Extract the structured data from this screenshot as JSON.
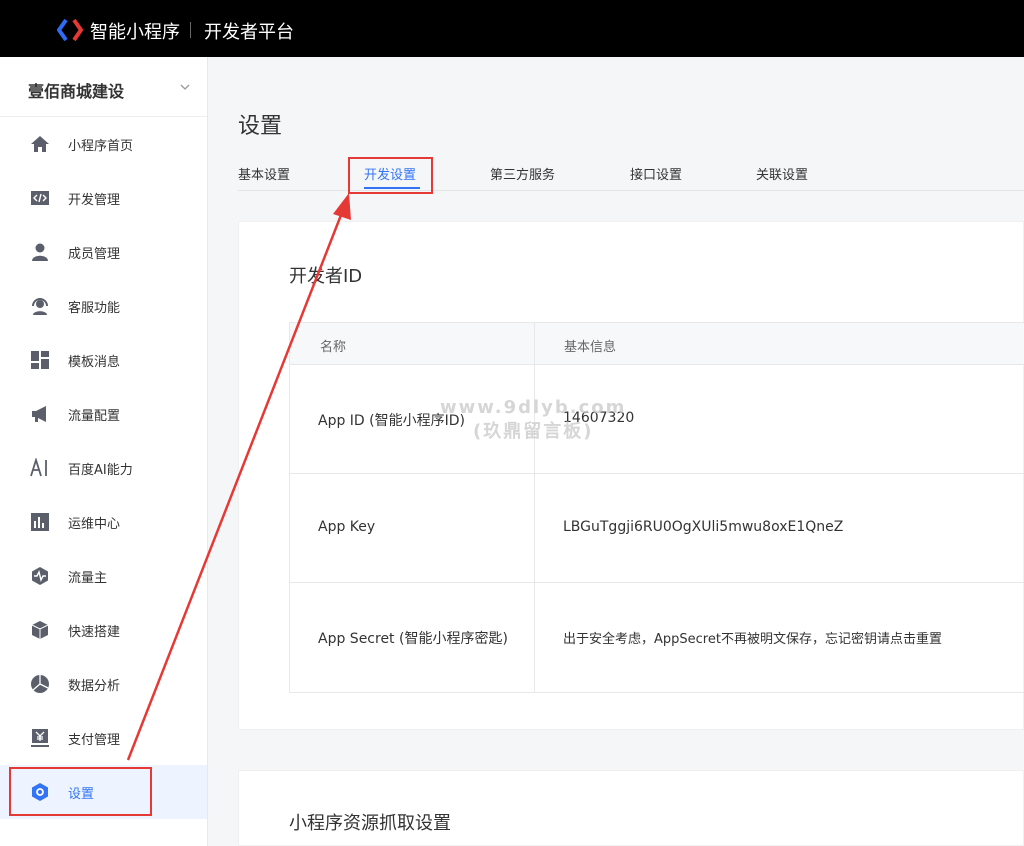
{
  "header": {
    "brand": "智能小程序",
    "subtitle": "开发者平台"
  },
  "sidebar": {
    "account_name": "壹佰商城建设",
    "items": [
      {
        "label": "小程序首页",
        "icon": "home-icon"
      },
      {
        "label": "开发管理",
        "icon": "code-icon"
      },
      {
        "label": "成员管理",
        "icon": "user-icon"
      },
      {
        "label": "客服功能",
        "icon": "headset-icon"
      },
      {
        "label": "模板消息",
        "icon": "template-icon"
      },
      {
        "label": "流量配置",
        "icon": "megaphone-icon"
      },
      {
        "label": "百度AI能力",
        "icon": "ai-icon"
      },
      {
        "label": "运维中心",
        "icon": "bar-chart-icon"
      },
      {
        "label": "流量主",
        "icon": "pulse-icon"
      },
      {
        "label": "快速搭建",
        "icon": "cube-icon"
      },
      {
        "label": "数据分析",
        "icon": "pie-chart-icon"
      },
      {
        "label": "支付管理",
        "icon": "yen-icon"
      },
      {
        "label": "设置",
        "icon": "settings-icon"
      }
    ],
    "active_index": 12
  },
  "main": {
    "title": "设置",
    "tabs": [
      {
        "label": "基本设置"
      },
      {
        "label": "开发设置"
      },
      {
        "label": "第三方服务"
      },
      {
        "label": "接口设置"
      },
      {
        "label": "关联设置"
      }
    ],
    "active_tab": 1,
    "developer_section": {
      "title": "开发者ID",
      "columns": [
        "名称",
        "基本信息"
      ],
      "rows": [
        {
          "name": "App ID (智能小程序ID)",
          "value": "14607320"
        },
        {
          "name": "App Key",
          "value": "LBGuTggji6RU0OgXUli5mwu8oxE1QneZ"
        },
        {
          "name": "App Secret (智能小程序密匙)",
          "value": "出于安全考虑，AppSecret不再被明文保存，忘记密钥请点击重置"
        }
      ]
    },
    "resource_section": {
      "title": "小程序资源抓取设置"
    }
  },
  "watermark": {
    "line1": "www.9dlyb.com",
    "line2": "(玖鼎留言板)"
  },
  "colors": {
    "accent": "#3374f6",
    "annotation": "#e53935",
    "topbar": "#000000"
  }
}
